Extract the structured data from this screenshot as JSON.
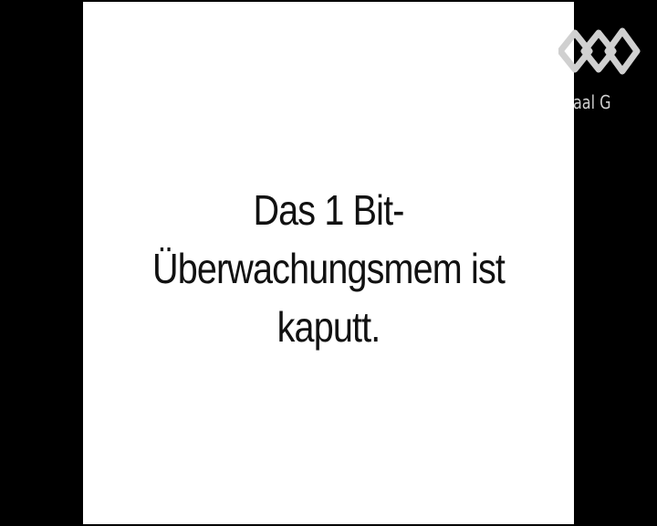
{
  "slide": {
    "lines": [
      "Das 1 Bit-",
      "Überwachungsmem ist",
      "kaputt."
    ]
  },
  "channel": {
    "logo_icon": "channel-logo-icon",
    "label": "aal G"
  },
  "colors": {
    "background": "#000000",
    "slide": "#ffffff",
    "text": "#111111",
    "logo": "#d0d0d0"
  }
}
